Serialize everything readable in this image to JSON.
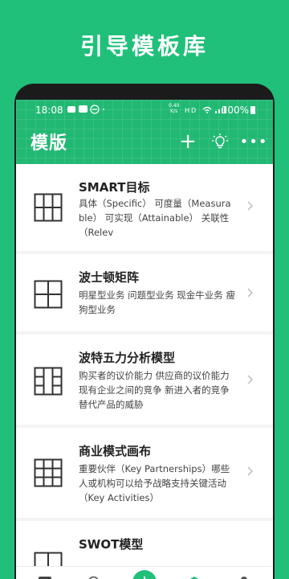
{
  "promo": {
    "title": "引导模板库"
  },
  "status_bar": {
    "time": "18:08",
    "speed_value": "0.40",
    "speed_unit": "K/s",
    "network": "HD",
    "battery": "100%"
  },
  "header": {
    "title": "模版",
    "add_icon": "plus-icon",
    "bulb_icon": "lightbulb-icon",
    "more_icon": "more-icon",
    "add_label": "+",
    "more_label": "•••"
  },
  "templates": [
    {
      "title": "SMART目标",
      "description": "具体（Specific） 可度量（Measurable） 可实现（Attainable） 关联性（Relev",
      "icon": "grid-2x2-split-icon"
    },
    {
      "title": "波士顿矩阵",
      "description": "明星型业务 问题型业务 现金牛业务 瘦狗型业务",
      "icon": "grid-2x2-icon"
    },
    {
      "title": "波特五力分析模型",
      "description": "购买者的议价能力 供应商的议价能力 现有企业之间的竞争 新进入者的竞争 替代产品的威胁",
      "icon": "grid-five-forces-icon"
    },
    {
      "title": "商业模式画布",
      "description": "重要伙伴（Key Partnerships）哪些人或机构可以给予战略支持关键活动（Key Activities）",
      "icon": "grid-3x3-icon"
    },
    {
      "title": "SWOT模型",
      "description": "",
      "icon": "grid-swot-icon"
    }
  ],
  "tabbar": {
    "items": [
      {
        "icon": "document-icon"
      },
      {
        "icon": "search-icon"
      },
      {
        "icon": "add-icon",
        "label": "+"
      },
      {
        "icon": "layers-icon"
      },
      {
        "icon": "person-icon"
      }
    ]
  },
  "colors": {
    "brand_green": "#20c07a",
    "header_green": "#21b873",
    "card_bg": "#ffffff",
    "list_bg": "#f4f4f4",
    "title_text": "#222222",
    "desc_text": "#444444",
    "chevron": "#bdbdbd"
  }
}
